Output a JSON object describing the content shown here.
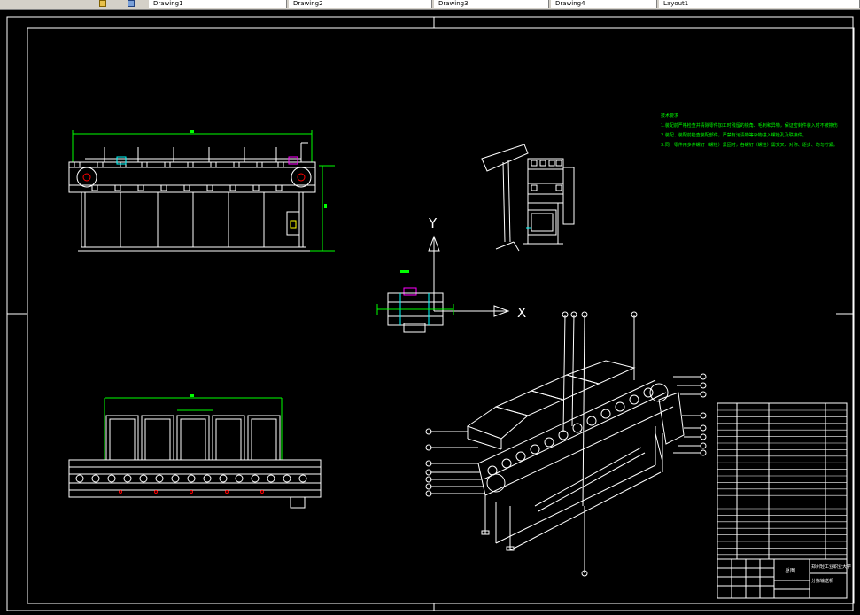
{
  "toolbar": {
    "tabs": [
      {
        "label": "Drawing1"
      },
      {
        "label": "Drawing2"
      },
      {
        "label": "Drawing3"
      },
      {
        "label": "Drawing4"
      },
      {
        "label": "Layout1"
      }
    ]
  },
  "axes": {
    "x_label": "X",
    "y_label": "Y"
  },
  "notes": {
    "title": "技术要求",
    "lines": [
      "1.装配前严格检查并清除零件加工时残留的锐角、毛刺和异物，保证密封件装入时不被擦伤。",
      "2.装配、装配前检查装配部件，严禁有污渍物等杂物进入螺栓孔及联接件。",
      "3.同一零件用多件螺钉（螺栓）紧固时，各螺钉（螺栓）需交叉、对称、逐步、均匀拧紧。"
    ]
  },
  "title_block": {
    "school": "郑州轻工业职业大学",
    "drawing_name": "分拣输送机",
    "label_main": "总图"
  },
  "colors": {
    "background": "#000000",
    "lines": "#ffffff",
    "accent_green": "#00ff00",
    "accent_red": "#ff0000",
    "accent_magenta": "#ff00ff",
    "accent_cyan": "#00ffff"
  }
}
